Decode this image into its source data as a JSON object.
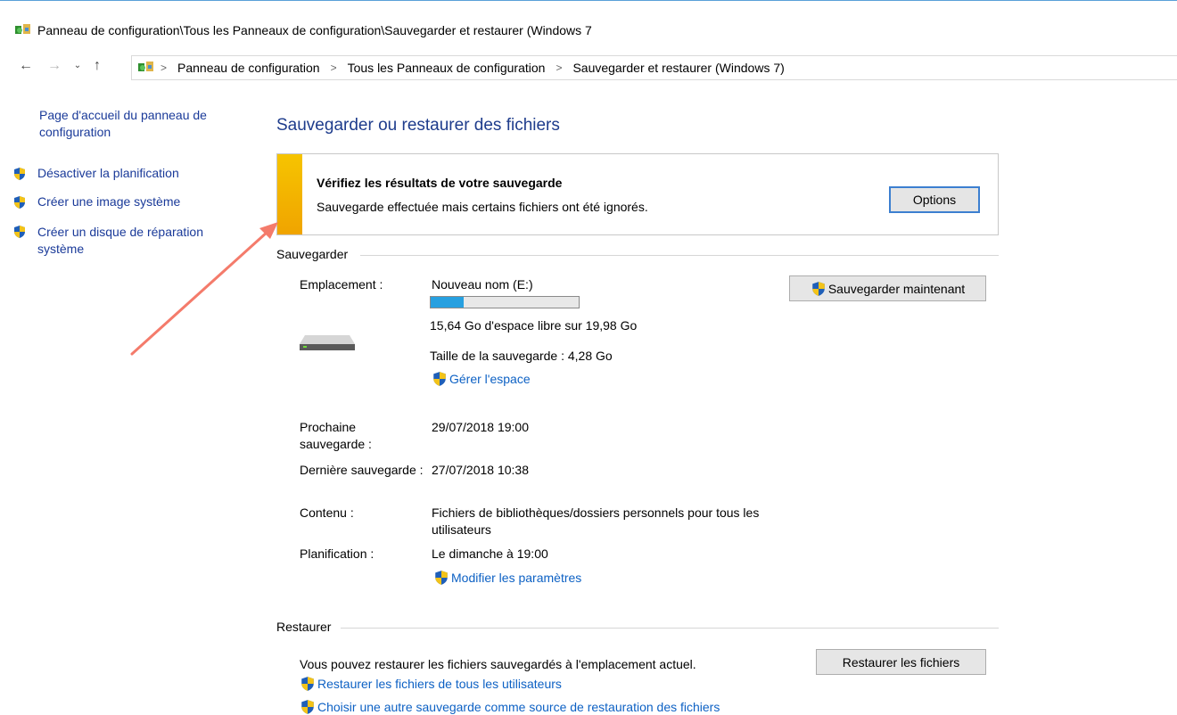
{
  "window": {
    "title": "Panneau de configuration\\Tous les Panneaux de configuration\\Sauvegarder et restaurer (Windows 7",
    "icon": "control-panel-icon"
  },
  "address_bar": {
    "breadcrumbs": [
      "Panneau de configuration",
      "Tous les Panneaux de configuration",
      "Sauvegarder et restaurer (Windows 7)"
    ]
  },
  "sidebar": {
    "home_link": "Page d'accueil du panneau de configuration",
    "items": [
      {
        "label": "Désactiver la planification",
        "icon": "uac-shield-icon"
      },
      {
        "label": "Créer une image système",
        "icon": "uac-shield-icon"
      },
      {
        "label": "Créer un disque de réparation système",
        "icon": "uac-shield-icon"
      }
    ]
  },
  "main": {
    "heading": "Sauvegarder ou restaurer des fichiers",
    "banner": {
      "title": "Vérifiez les résultats de votre sauvegarde",
      "message": "Sauvegarde effectuée mais certains fichiers ont été ignorés.",
      "options_button": "Options",
      "accent_color": "#f4b400"
    },
    "backup": {
      "section_label": "Sauvegarder",
      "location_label": "Emplacement :",
      "location_value": "Nouveau nom (E:)",
      "usage_fraction": 0.22,
      "free_space": "15,64 Go d'espace libre sur 19,98 Go",
      "backup_size": "Taille de la sauvegarde : 4,28 Go",
      "manage_space_link": "Gérer l'espace",
      "backup_now_button": "Sauvegarder maintenant",
      "next_backup_label": "Prochaine sauvegarde :",
      "next_backup_value": "29/07/2018 19:00",
      "last_backup_label": "Dernière sauvegarde :",
      "last_backup_value": "27/07/2018 10:38",
      "contents_label": "Contenu :",
      "contents_value": "Fichiers de bibliothèques/dossiers personnels pour tous les utilisateurs",
      "schedule_label": "Planification :",
      "schedule_value": "Le dimanche à 19:00",
      "change_settings_link": "Modifier les paramètres"
    },
    "restore": {
      "section_label": "Restaurer",
      "message": "Vous pouvez restaurer les fichiers sauvegardés à l'emplacement actuel.",
      "restore_button": "Restaurer les fichiers",
      "restore_all_users_link": "Restaurer les fichiers de tous les utilisateurs",
      "choose_backup_link": "Choisir une autre sauvegarde comme source de restauration des fichiers"
    }
  },
  "colors": {
    "link": "#0d61c4",
    "heading": "#1e3c8c",
    "progress_fill": "#27a0e0",
    "annotation_arrow": "#f47b6b"
  }
}
